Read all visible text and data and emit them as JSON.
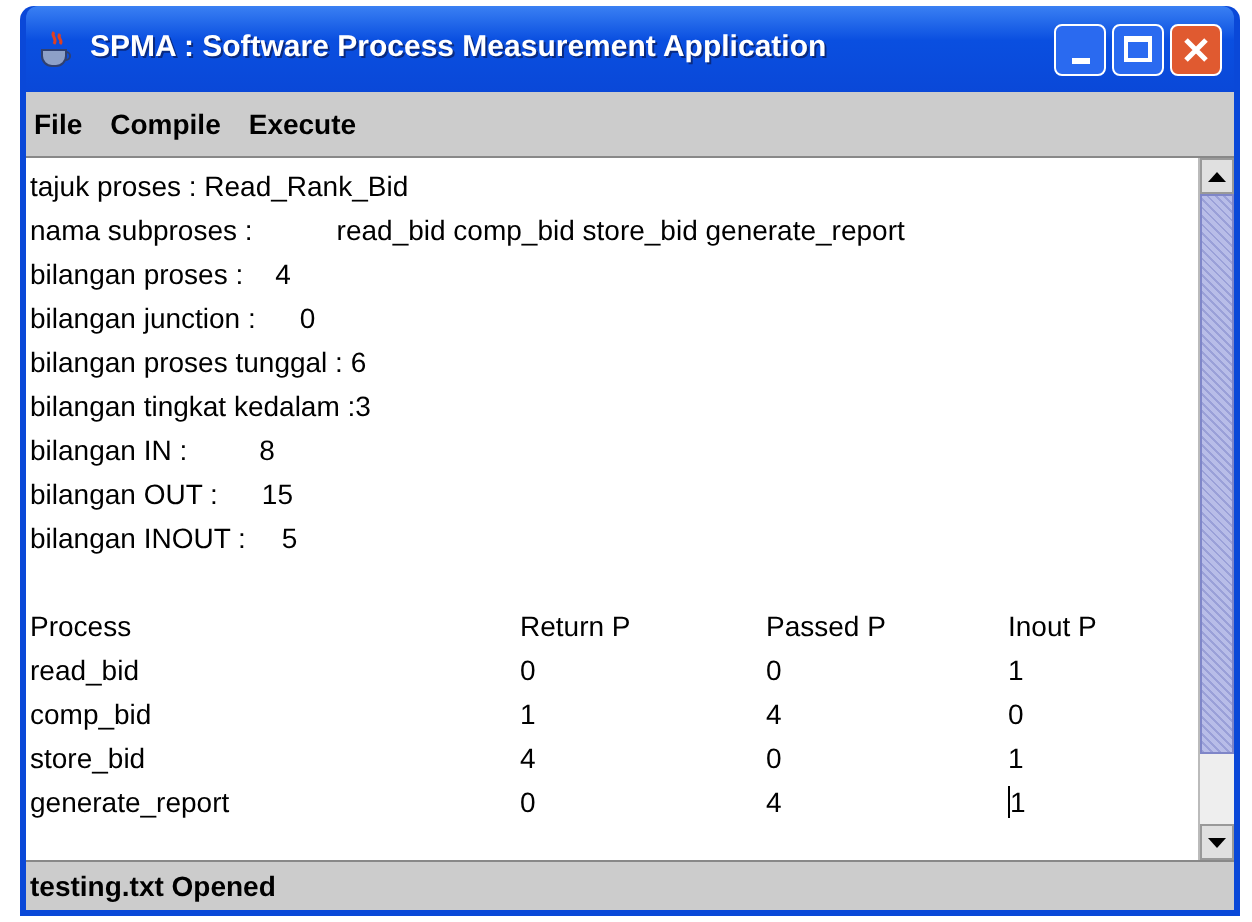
{
  "window": {
    "title": "SPMA : Software Process Measurement Application"
  },
  "menu": [
    "File",
    "Compile",
    "Execute"
  ],
  "info_lines": [
    {
      "label": "tajuk proses : Read_Rank_Bid"
    },
    {
      "label": "nama subproses :",
      "value": "read_bid comp_bid store_bid generate_report"
    },
    {
      "label": "bilangan proses :",
      "value": "4"
    },
    {
      "label": "bilangan junction :",
      "value": "0"
    },
    {
      "label": "bilangan proses tunggal : 6"
    },
    {
      "label": "bilangan tingkat kedalam :3"
    },
    {
      "label": "bilangan IN :",
      "value": "8"
    },
    {
      "label": "bilangan OUT :",
      "value": "15"
    },
    {
      "label": "bilangan INOUT :",
      "value": "5"
    }
  ],
  "table": {
    "columns": [
      "Process",
      "Return P",
      "Passed P",
      "Inout P"
    ],
    "rows": [
      [
        "read_bid",
        "0",
        "0",
        "1"
      ],
      [
        "comp_bid",
        "1",
        "4",
        "0"
      ],
      [
        "store_bid",
        "4",
        "0",
        "1"
      ],
      [
        "generate_report",
        "0",
        "4",
        "1"
      ]
    ]
  },
  "status_bar": "testing.txt Opened"
}
